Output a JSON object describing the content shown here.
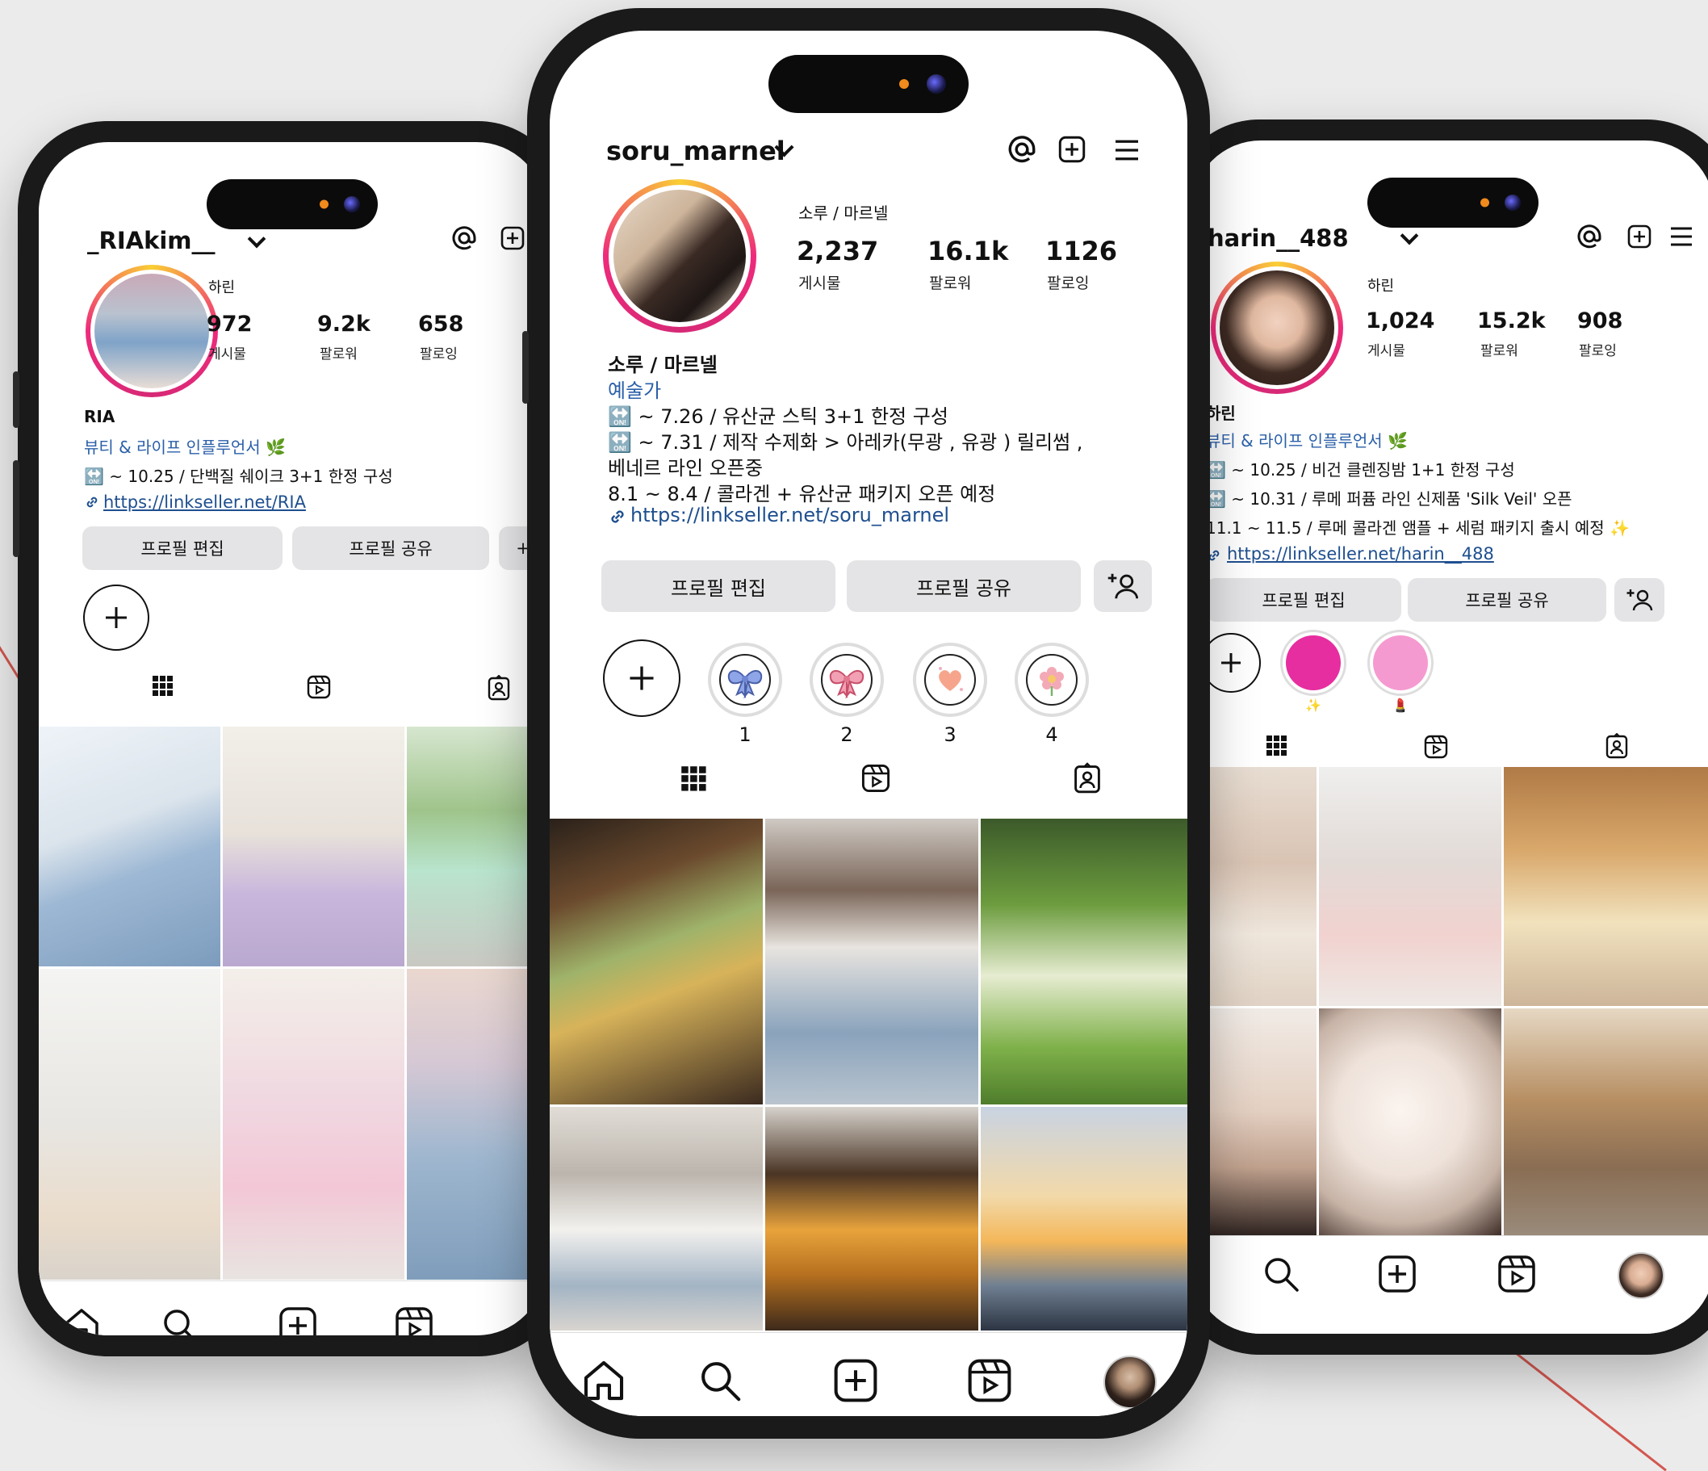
{
  "colors": {
    "background": "#ebebeb",
    "phone_frame": "#1a1a1a",
    "link": "#1e4f8f",
    "category": "#2a5fa8",
    "button_bg": "#e4e4e6",
    "accent_line": "#d2574f",
    "highlight_magenta": "#e62ea0",
    "highlight_pink": "#f59ad0"
  },
  "phones": {
    "left": {
      "username": "_RIAkim__",
      "display_name": "하린",
      "stats": [
        {
          "value": "972",
          "label": "게시물"
        },
        {
          "value": "9.2k",
          "label": "팔로워"
        },
        {
          "value": "658",
          "label": "팔로잉"
        }
      ],
      "bio_name": "RIA",
      "category": "뷰티 & 라이프 인플루언서 🌿",
      "bio_lines": [
        "🔛 ~ 10.25 / 단백질 쉐이크 3+1 한정 구성"
      ],
      "link": "https://linkseller.net/RIA",
      "buttons": {
        "edit": "프로필 편집",
        "share": "프로필 공유"
      },
      "icons": [
        "at-icon",
        "add-post-icon"
      ]
    },
    "center": {
      "username": "soru_marnel",
      "display_name": "소루 / 마르넬",
      "stats": [
        {
          "value": "2,237",
          "label": "게시물"
        },
        {
          "value": "16.1k",
          "label": "팔로워"
        },
        {
          "value": "1126",
          "label": "팔로잉"
        }
      ],
      "bio_name": "소루 / 마르넬",
      "category": "예술가",
      "bio_lines": [
        "🔛 ~ 7.26 / 유산균 스틱 3+1 한정 구성",
        "🔛 ~ 7.31 / 제작 수제화 > 아레카(무광 , 유광 ) 릴리썸 ,",
        "베네르 라인 오픈중",
        "8.1 ~ 8.4 / 콜라겐 + 유산균 패키지 오픈 예정"
      ],
      "link": "https://linkseller.net/soru_marnel",
      "buttons": {
        "edit": "프로필 편집",
        "share": "프로필 공유"
      },
      "highlights": [
        {
          "label": "1",
          "icon": "blue-ribbon-icon"
        },
        {
          "label": "2",
          "icon": "pink-ribbon-icon"
        },
        {
          "label": "3",
          "icon": "heart-icon"
        },
        {
          "label": "4",
          "icon": "flower-icon"
        }
      ]
    },
    "right": {
      "username": "harin__488",
      "display_name": "하린",
      "stats": [
        {
          "value": "1,024",
          "label": "게시물"
        },
        {
          "value": "15.2k",
          "label": "팔로워"
        },
        {
          "value": "908",
          "label": "팔로잉"
        }
      ],
      "bio_name": "하린",
      "category": "뷰티 & 라이프 인플루언서 🌿",
      "bio_lines": [
        "🔛 ~ 10.25 / 비건 클렌징밤 1+1 한정 구성",
        "🔛 ~ 10.31 / 루메 퍼퓸 라인 신제품 'Silk Veil' 오픈",
        "11.1 ~ 11.5 / 루메 콜라겐 앰플 + 세럼 패키지 출시 예정 ✨"
      ],
      "link": "https://linkseller.net/harin__488",
      "buttons": {
        "edit": "프로필 편집",
        "share": "프로필 공유"
      },
      "highlights": [
        {
          "label": "✨",
          "icon": "magenta-circle-icon"
        },
        {
          "label": "💄",
          "icon": "pink-circle-icon"
        }
      ]
    }
  }
}
